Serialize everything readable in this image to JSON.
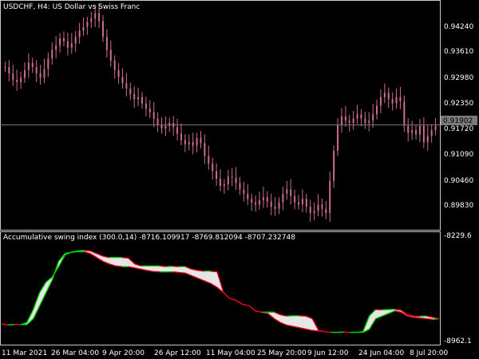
{
  "colors": {
    "background": "#000000",
    "frame": "#c8c8c8",
    "candle": "#c8708a",
    "price_line": "#7a7a7a",
    "price_badge_bg": "#7a7a7a",
    "price_badge_text": "#000000",
    "indicator_fill": "#e6e6e6",
    "indicator_line_up": "#00d000",
    "indicator_line_down": "#e00020",
    "text": "#ffffff"
  },
  "header": {
    "symbol_title": "USDCHF, H4:  US Dollar vs Swiss Franc"
  },
  "price_panel": {
    "current_price": "0.91902",
    "y_ticks": [
      "0.94240",
      "0.93610",
      "0.92980",
      "0.92350",
      "0.91720",
      "0.91090",
      "0.90460",
      "0.89830"
    ]
  },
  "indicator_panel": {
    "title": "Accumulative swing index (300.0,14) -8716.109917 -8769.812094 -8707.232748",
    "y_ticks": [
      "-8229.6",
      "-8962.1"
    ]
  },
  "x_axis": {
    "labels": [
      "11 Mar 2021",
      "26 Mar 04:00",
      "9 Apr 20:00",
      "26 Apr 12:00",
      "11 May 04:00",
      "25 May 20:00",
      "9 Jun 12:00",
      "24 Jun 04:00",
      "8 Jul 20:00"
    ]
  },
  "chart_data": [
    {
      "type": "candlestick",
      "title": "USDCHF, H4:  US Dollar vs Swiss Franc",
      "ylim": [
        0.895,
        0.9455
      ],
      "x_index_range": [
        0,
        110
      ],
      "close_series": [
        0.9325,
        0.931,
        0.9295,
        0.929,
        0.93,
        0.9318,
        0.9335,
        0.9325,
        0.931,
        0.93,
        0.932,
        0.9345,
        0.9365,
        0.9375,
        0.9392,
        0.9385,
        0.937,
        0.938,
        0.9395,
        0.941,
        0.9418,
        0.943,
        0.9438,
        0.945,
        0.9432,
        0.9395,
        0.9365,
        0.934,
        0.9318,
        0.9302,
        0.9287,
        0.9275,
        0.9262,
        0.925,
        0.9255,
        0.924,
        0.9228,
        0.922,
        0.9205,
        0.919,
        0.9182,
        0.9188,
        0.9195,
        0.9185,
        0.917,
        0.9155,
        0.9145,
        0.915,
        0.9142,
        0.916,
        0.9148,
        0.9118,
        0.91,
        0.9083,
        0.9065,
        0.9048,
        0.9052,
        0.907,
        0.9068,
        0.9055,
        0.904,
        0.903,
        0.9018,
        0.901,
        0.9005,
        0.9015,
        0.9022,
        0.9012,
        0.9,
        0.8995,
        0.901,
        0.903,
        0.904,
        0.9025,
        0.901,
        0.9005,
        0.9018,
        0.9,
        0.8985,
        0.899,
        0.9005,
        0.8995,
        0.8985,
        0.906,
        0.913,
        0.919,
        0.921,
        0.92,
        0.9195,
        0.9205,
        0.9215,
        0.9205,
        0.9195,
        0.92,
        0.9215,
        0.9235,
        0.9255,
        0.9265,
        0.925,
        0.924,
        0.9255,
        0.9245,
        0.9188,
        0.9172,
        0.9178,
        0.9168,
        0.9188,
        0.915,
        0.9165,
        0.9178,
        0.9188
      ],
      "current_price": 0.91902
    },
    {
      "type": "area",
      "title": "Accumulative swing index (300.0,14)",
      "ylim": [
        -8975,
        -8215
      ],
      "series": [
        {
          "values": [
            -8840,
            -8848,
            -8845,
            -8846,
            -8830,
            -8730,
            -8600,
            -8520,
            -8480,
            -8400,
            -8310,
            -8290,
            -8280,
            -8275,
            -8280,
            -8300,
            -8320,
            -8330,
            -8330,
            -8330,
            -8335,
            -8380,
            -8395,
            -8395,
            -8395,
            -8395,
            -8400,
            -8398,
            -8400,
            -8400,
            -8420,
            -8430,
            -8435,
            -8435,
            -8440,
            -8600,
            -8645,
            -8660,
            -8690,
            -8700,
            -8740,
            -8750,
            -8750,
            -8750,
            -8770,
            -8780,
            -8778,
            -8778,
            -8780,
            -8800,
            -8890,
            -8900,
            -8905,
            -8905,
            -8903,
            -8905,
            -8905,
            -8900,
            -8780,
            -8730,
            -8732,
            -8730,
            -8728,
            -8735,
            -8770,
            -8780,
            -8782,
            -8780,
            -8790,
            -8800
          ]
        },
        {
          "values": [
            -8840,
            -8848,
            -8845,
            -8846,
            -8845,
            -8800,
            -8700,
            -8600,
            -8500,
            -8360,
            -8300,
            -8290,
            -8285,
            -8285,
            -8300,
            -8330,
            -8360,
            -8380,
            -8395,
            -8400,
            -8400,
            -8410,
            -8420,
            -8430,
            -8438,
            -8440,
            -8440,
            -8440,
            -8445,
            -8450,
            -8470,
            -8490,
            -8510,
            -8530,
            -8560,
            -8600,
            -8645,
            -8660,
            -8690,
            -8700,
            -8740,
            -8750,
            -8760,
            -8800,
            -8830,
            -8850,
            -8860,
            -8870,
            -8880,
            -8890,
            -8895,
            -8900,
            -8905,
            -8905,
            -8903,
            -8905,
            -8905,
            -8905,
            -8880,
            -8800,
            -8780,
            -8760,
            -8740,
            -8750,
            -8780,
            -8790,
            -8795,
            -8800,
            -8805,
            -8800
          ]
        }
      ]
    }
  ]
}
